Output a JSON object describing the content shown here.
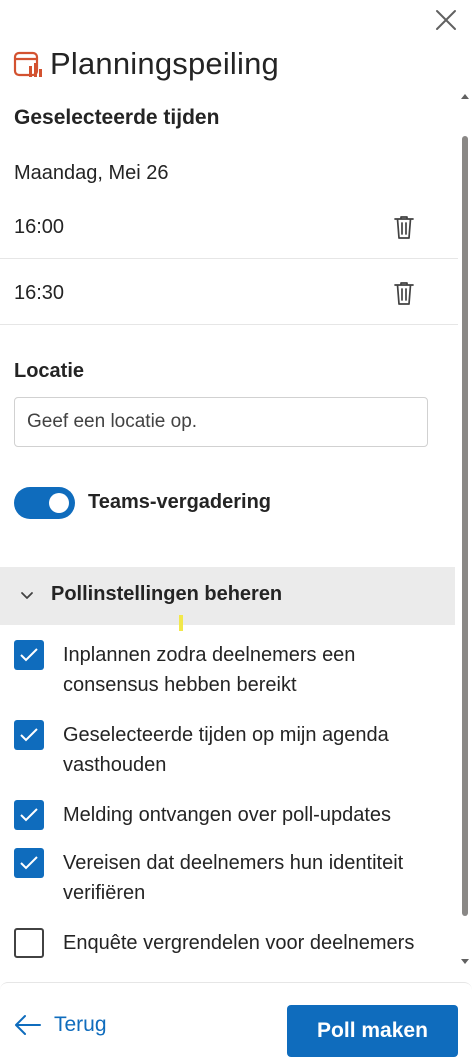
{
  "header": {
    "title": "Planningspeiling"
  },
  "selected": {
    "title": "Geselecteerde tijden",
    "date": "Maandag, Mei 26",
    "times": [
      "16:00",
      "16:30"
    ]
  },
  "location": {
    "label": "Locatie",
    "placeholder": "Geef een locatie op."
  },
  "teams": {
    "label": "Teams-vergadering",
    "enabled": true
  },
  "settings": {
    "title": "Pollinstellingen beheren",
    "options": [
      {
        "label": "Inplannen zodra deelnemers een consensus hebben bereikt",
        "checked": true
      },
      {
        "label": "Geselecteerde tijden op mijn agenda vasthouden",
        "checked": true
      },
      {
        "label": "Melding ontvangen over poll-updates",
        "checked": true
      },
      {
        "label": "Vereisen dat deelnemers hun identiteit verifiëren",
        "checked": true
      },
      {
        "label": "Enquête vergrendelen voor deelnemers",
        "checked": false
      }
    ]
  },
  "footer": {
    "back_label": "Terug",
    "create_label": "Poll maken"
  },
  "colors": {
    "accent": "#0f6cbd",
    "app_icon": "#d35230"
  }
}
